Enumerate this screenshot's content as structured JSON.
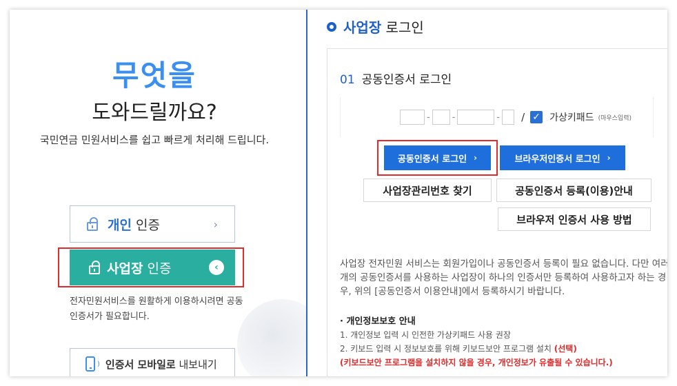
{
  "left": {
    "hero_title": "무엇을",
    "hero_subtitle": "도와드릴까요?",
    "hero_desc": "국민연금 민원서비스를 쉽고 빠르게 처리해 드립니다.",
    "personal_bold": "개인",
    "personal_rest": " 인증",
    "personal_chevron": "›",
    "biz_bold": "사업장",
    "biz_rest": " 인증",
    "biz_chevron": "‹",
    "biz_note": "전자민원서비스를 원활하게 이용하시려면 공동인증서가 필요합니다.",
    "mobile_bold": "인증서 모바일로",
    "mobile_rest": " 내보내기"
  },
  "right": {
    "title_bold": "사업장",
    "title_rest": " 로그인",
    "step_num": "01",
    "step_label": "공동인증서 로그인",
    "dash": "-",
    "slash": "/",
    "checkmark": "✓",
    "virtual_keypad": "가상키패드",
    "virtual_keypad_sub": "(마우스입력)",
    "btn_cert_login": "공동인증서 로그인",
    "btn_browser_login": "브라우저인증서 로그인",
    "arrow": "›",
    "btn_find_bizno": "사업장관리번호 찾기",
    "btn_cert_register": "공동인증서 등록(이용)안내",
    "btn_browser_howto": "브라우저 인증서 사용 방법",
    "info_text": "사업장 전자민원 서비스는 회원가입이나 공동인증서 등록이 필요 없습니다. 다만 여러개의 공동인증서를 사용하는 사업장이 하나의 인증서만 등록하여 사용하고자 하는 경우, 위의 [공동인증서 이용안내]에서 등록하시기 바랍니다.",
    "privacy_title": "· 개인정보보호 안내",
    "privacy_1": "1. 개인정보 입력 시 인전한 가상키패드 사용 권장",
    "privacy_2": "2. 키보드 입력 시 정보보호를 위해 키보드보안 프로그램 설치 ",
    "privacy_2_red": "(선택)",
    "privacy_3": "(키보드보안 프로그램을 설치하지 않을 경우, 개인정보가 유출될 수 있습니다.)"
  },
  "colors": {
    "accent_blue": "#1f5fc8",
    "teal": "#2aaea0",
    "highlight_red": "#e12a2a",
    "button_blue": "#1e6fdc"
  }
}
